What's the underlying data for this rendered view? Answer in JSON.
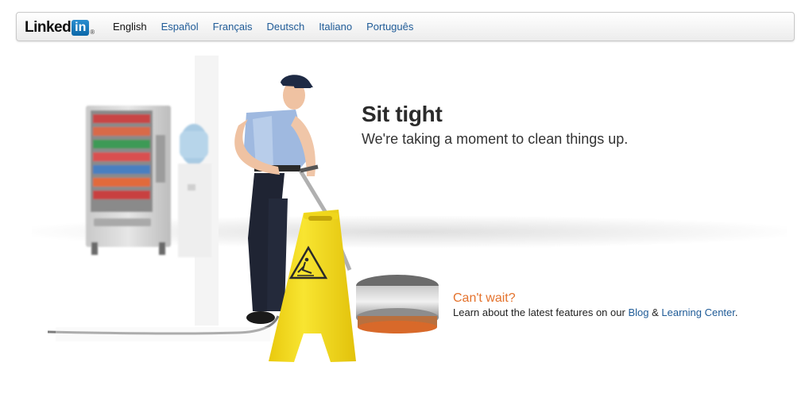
{
  "brand": {
    "logo_text": "Linked",
    "logo_box_text": "in",
    "logo_mark": "®"
  },
  "languages": [
    {
      "label": "English",
      "active": true
    },
    {
      "label": "Español",
      "active": false
    },
    {
      "label": "Français",
      "active": false
    },
    {
      "label": "Deutsch",
      "active": false
    },
    {
      "label": "Italiano",
      "active": false
    },
    {
      "label": "Português",
      "active": false
    }
  ],
  "message": {
    "headline": "Sit tight",
    "subline": "We're taking a moment to clean things up."
  },
  "cta": {
    "title": "Can't wait?",
    "text_before": "Learn about the latest features on our ",
    "link_blog": "Blog",
    "connector": " & ",
    "link_learning": "Learning Center",
    "text_after": "."
  },
  "colors": {
    "link": "#1f5b97",
    "accent_orange": "#e4722c",
    "sign_yellow": "#f5df1a",
    "brand_blue": "#0b67a8"
  },
  "icons": [
    "wet-floor-sign-icon",
    "janitor-illustration",
    "vending-machine-illustration",
    "water-cooler-illustration",
    "floor-buffer-illustration"
  ]
}
